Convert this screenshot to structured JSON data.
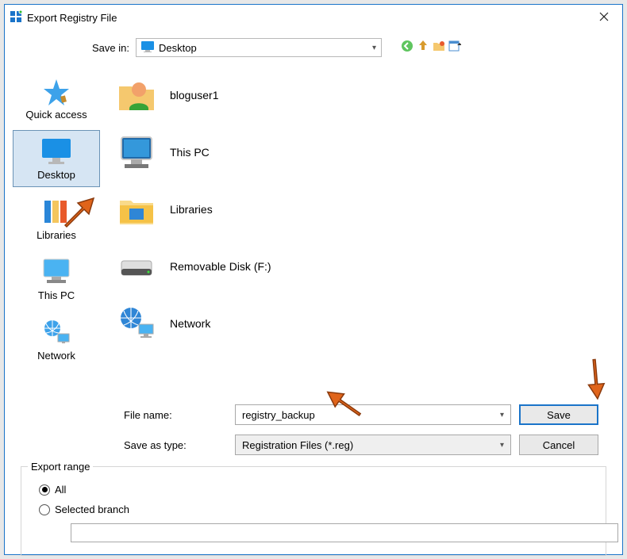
{
  "title": "Export Registry File",
  "toprow": {
    "label": "Save in:",
    "selected": "Desktop"
  },
  "shortcuts": [
    {
      "label": "Quick access"
    },
    {
      "label": "Desktop"
    },
    {
      "label": "Libraries"
    },
    {
      "label": "This PC"
    },
    {
      "label": "Network"
    }
  ],
  "files": [
    {
      "label": "bloguser1"
    },
    {
      "label": "This PC"
    },
    {
      "label": "Libraries"
    },
    {
      "label": "Removable Disk (F:)"
    },
    {
      "label": "Network"
    }
  ],
  "filename": {
    "label": "File name:",
    "value": "registry_backup"
  },
  "filetype": {
    "label": "Save as type:",
    "value": "Registration Files (*.reg)"
  },
  "buttons": {
    "save": "Save",
    "cancel": "Cancel"
  },
  "export": {
    "legend": "Export range",
    "all": "All",
    "selected_branch": "Selected branch",
    "branch_value": ""
  }
}
